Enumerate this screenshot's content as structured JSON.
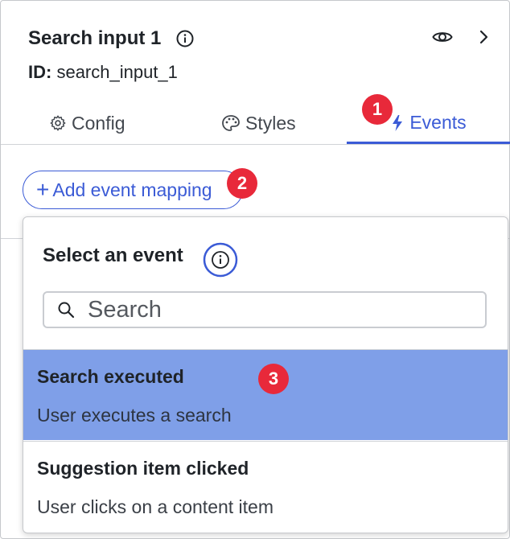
{
  "panel": {
    "title": "Search input 1",
    "id_label": "ID:",
    "id_value": "search_input_1"
  },
  "tabs": [
    {
      "label": "Config",
      "icon": "gear-icon",
      "active": false
    },
    {
      "label": "Styles",
      "icon": "palette-icon",
      "active": false
    },
    {
      "label": "Events",
      "icon": "lightning-icon",
      "active": true
    }
  ],
  "add_event_button": {
    "label": "Add event mapping"
  },
  "dropdown": {
    "title": "Select an event",
    "search_placeholder": "Search",
    "options": [
      {
        "title": "Search executed",
        "description": "User executes a search",
        "selected": true
      },
      {
        "title": "Suggestion item clicked",
        "description": "User clicks on a content item",
        "selected": false
      }
    ]
  },
  "badges": [
    "1",
    "2",
    "3"
  ],
  "colors": {
    "accent": "#3b5bd6",
    "badge": "#e8293a",
    "selected_row": "#7f9fe8"
  }
}
